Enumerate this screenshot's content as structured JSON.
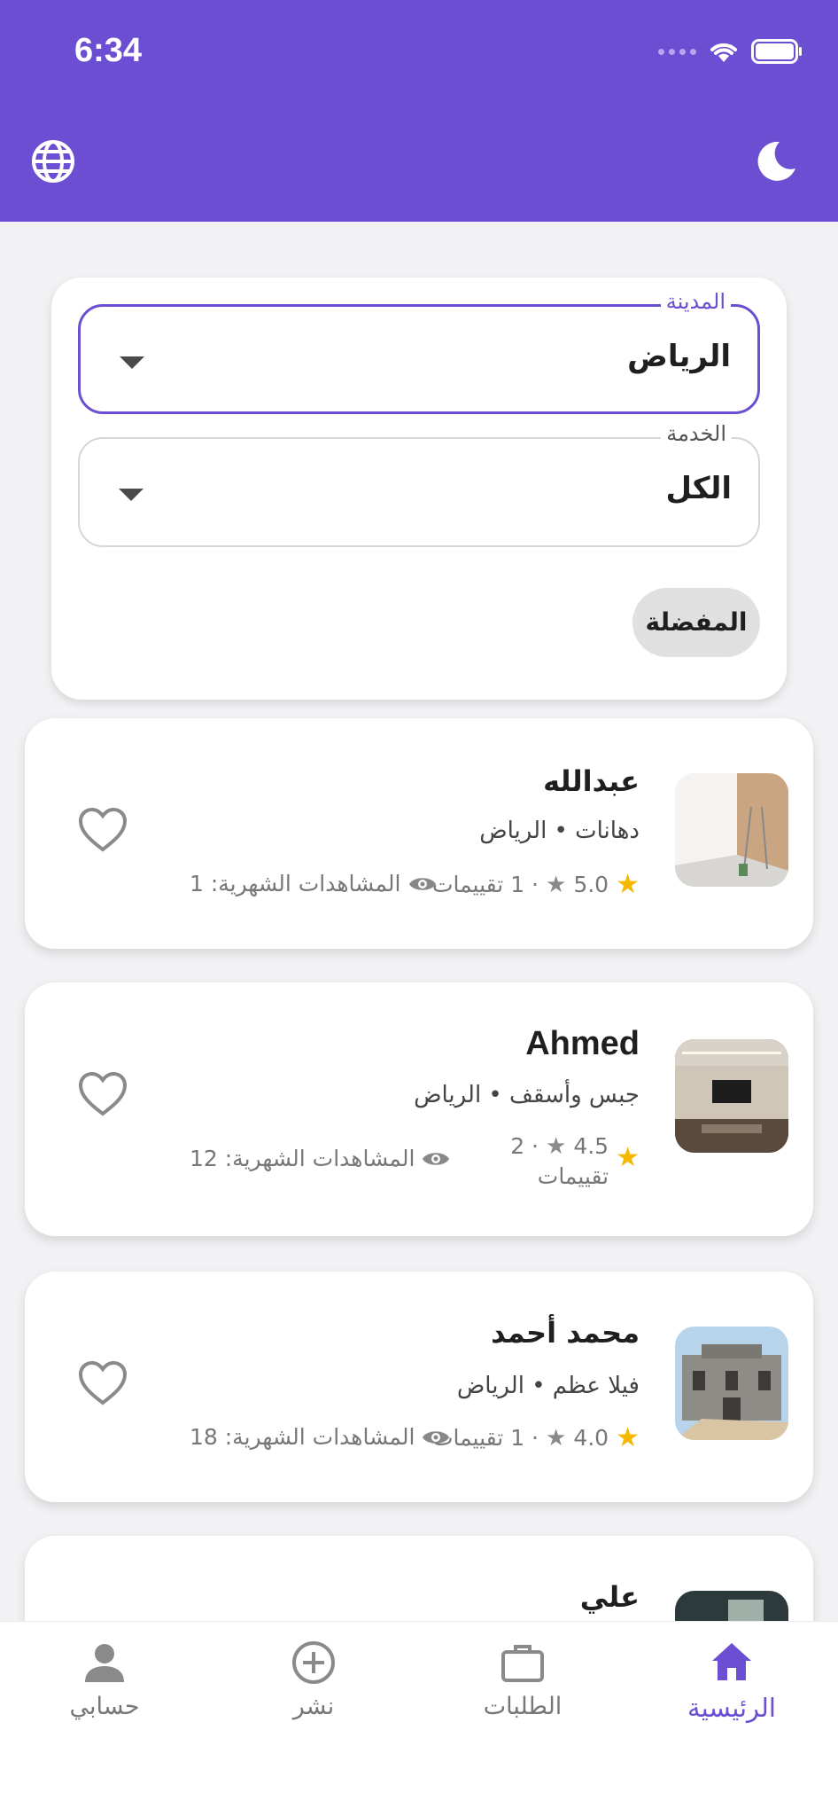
{
  "status_bar": {
    "time": "6:34",
    "icons": [
      "signal-dots-icon",
      "wifi-icon",
      "battery-icon"
    ]
  },
  "header": {
    "left_icon": "globe-icon",
    "right_icon": "moon-icon",
    "color": "#6b4ed1"
  },
  "filters": {
    "city": {
      "label": "المدينة",
      "value": "الرياض"
    },
    "service": {
      "label": "الخدمة",
      "value": "الكل"
    },
    "favorites_label": "المفضلة"
  },
  "listings": [
    {
      "name": "عبدالله",
      "subtitle": "دهانات • الرياض",
      "rating": "5.0",
      "reviews": "· 1 تقييمات",
      "views": "المشاهدات الشهرية: 1"
    },
    {
      "name": "Ahmed",
      "subtitle": "جبس وأسقف • الرياض",
      "rating": "4.5",
      "reviews_line1": "· 2",
      "reviews_line2": "تقييمات",
      "views": "المشاهدات الشهرية: 12"
    },
    {
      "name": "محمد أحمد",
      "subtitle": "فيلا عظم • الرياض",
      "rating": "4.0",
      "reviews": "· 1 تقييمات",
      "views": "المشاهدات الشهرية: 18"
    },
    {
      "name": "علي"
    }
  ],
  "bottom_nav": [
    {
      "label": "حسابي",
      "icon": "person-icon",
      "active": false
    },
    {
      "label": "نشر",
      "icon": "add-circle-icon",
      "active": false
    },
    {
      "label": "الطلبات",
      "icon": "briefcase-icon",
      "active": false
    },
    {
      "label": "الرئيسية",
      "icon": "home-icon",
      "active": true
    }
  ],
  "colors": {
    "accent": "#6b4ed1",
    "star": "#f5b800"
  }
}
